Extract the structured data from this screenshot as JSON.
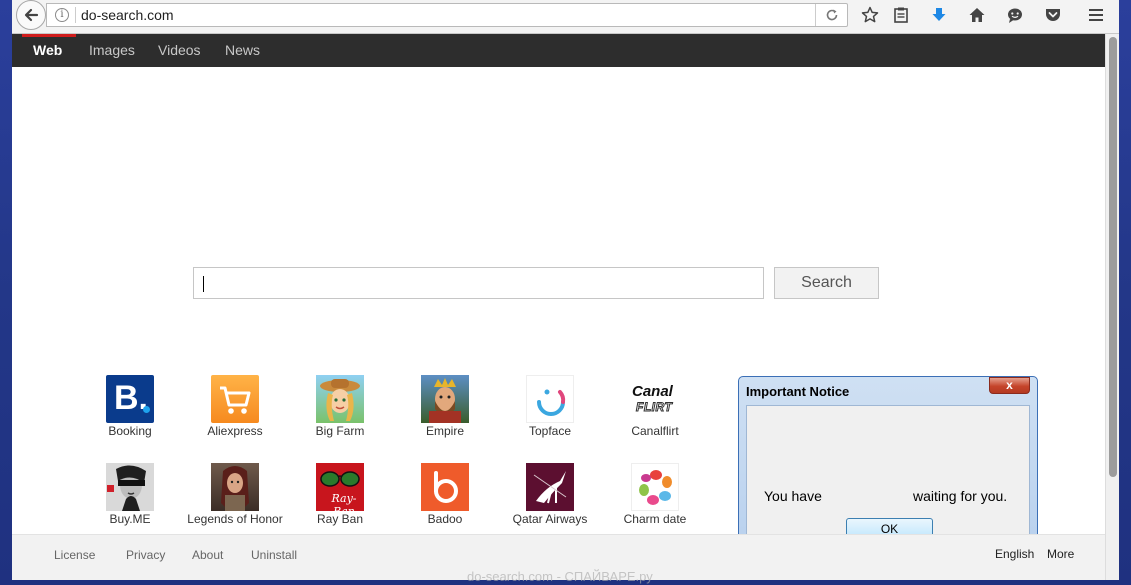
{
  "browser": {
    "url": "do-search.com",
    "info_glyph": "i"
  },
  "nav": {
    "tabs": [
      {
        "label": "Web"
      },
      {
        "label": "Images"
      },
      {
        "label": "Videos"
      },
      {
        "label": "News"
      }
    ]
  },
  "search": {
    "value": "",
    "button_label": "Search"
  },
  "tiles": [
    {
      "label": "Booking",
      "icon": "booking-icon"
    },
    {
      "label": "Aliexpress",
      "icon": "aliexpress-icon"
    },
    {
      "label": "Big Farm",
      "icon": "big-farm-icon"
    },
    {
      "label": "Empire",
      "icon": "empire-icon"
    },
    {
      "label": "Topface",
      "icon": "topface-icon"
    },
    {
      "label": "Canalflirt",
      "icon": "canalflirt-icon"
    },
    {
      "label": "Buy.ME",
      "icon": "buy-me-icon"
    },
    {
      "label": "Legends of Honor",
      "icon": "legends-of-honor-icon"
    },
    {
      "label": "Ray Ban",
      "icon": "ray-ban-icon"
    },
    {
      "label": "Badoo",
      "icon": "badoo-icon"
    },
    {
      "label": "Qatar Airways",
      "icon": "qatar-airways-icon"
    },
    {
      "label": "Charm date",
      "icon": "charm-date-icon"
    }
  ],
  "tile_logo_text": {
    "booking": "B.",
    "canal_line1": "Canal",
    "canal_line2": "FLIRT",
    "rayban": "Ray-Ban"
  },
  "dialog": {
    "title": "Important Notice",
    "close_glyph": "x",
    "message_part1": "You have",
    "message_part2": "waiting for you.",
    "ok_label": "OK"
  },
  "footer": {
    "links": [
      "License",
      "Privacy",
      "About",
      "Uninstall"
    ],
    "language": "English",
    "more": "More"
  },
  "watermark": "do-search.com - СПАЙВАРЕ.ру"
}
